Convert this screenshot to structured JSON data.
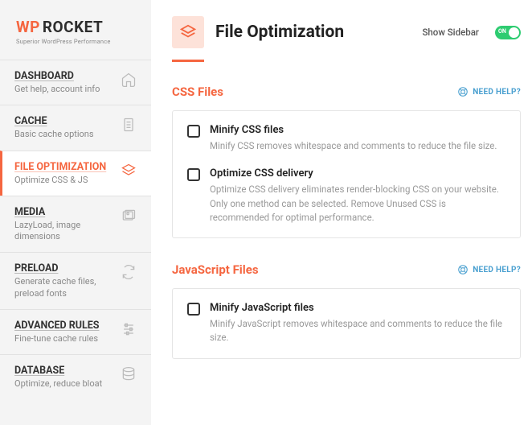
{
  "logo": {
    "wp": "WP",
    "rocket": "ROCKET",
    "tagline": "Superior WordPress Performance"
  },
  "nav": [
    {
      "title": "DASHBOARD",
      "sub": "Get help, account info"
    },
    {
      "title": "CACHE",
      "sub": "Basic cache options"
    },
    {
      "title": "FILE OPTIMIZATION",
      "sub": "Optimize CSS & JS"
    },
    {
      "title": "MEDIA",
      "sub": "LazyLoad, image dimensions"
    },
    {
      "title": "PRELOAD",
      "sub": "Generate cache files, preload fonts"
    },
    {
      "title": "ADVANCED RULES",
      "sub": "Fine-tune cache rules"
    },
    {
      "title": "DATABASE",
      "sub": "Optimize, reduce bloat"
    }
  ],
  "header": {
    "title": "File Optimization",
    "show_sidebar": "Show Sidebar",
    "toggle": "ON"
  },
  "sections": [
    {
      "title": "CSS Files",
      "help": "NEED HELP?",
      "options": [
        {
          "title": "Minify CSS files",
          "desc": "Minify CSS removes whitespace and comments to reduce the file size."
        },
        {
          "title": "Optimize CSS delivery",
          "desc": "Optimize CSS delivery eliminates render-blocking CSS on your website. Only one method can be selected. Remove Unused CSS is recommended for optimal performance."
        }
      ]
    },
    {
      "title": "JavaScript Files",
      "help": "NEED HELP?",
      "options": [
        {
          "title": "Minify JavaScript files",
          "desc": "Minify JavaScript removes whitespace and comments to reduce the file size."
        }
      ]
    }
  ]
}
